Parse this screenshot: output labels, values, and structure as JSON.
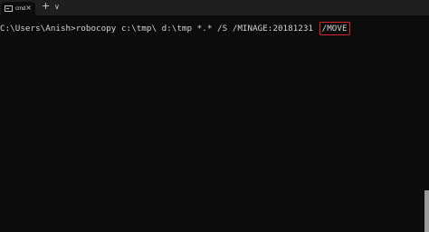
{
  "tab": {
    "title": "cmd",
    "icon": "terminal-icon",
    "close_glyph": "×"
  },
  "toolbar": {
    "new_tab_glyph": "+",
    "dropdown_glyph": "∨"
  },
  "console": {
    "command": "C:\\Users\\Anish>robocopy c:\\tmp\\ d:\\tmp *.* /S /MINAGE:20181231",
    "highlighted_arg": "/MOVE"
  },
  "colors": {
    "background": "#0c0c0c",
    "titlebar": "#1f1f1f",
    "text": "#d4d4d4",
    "highlight_border": "#d9262b"
  }
}
